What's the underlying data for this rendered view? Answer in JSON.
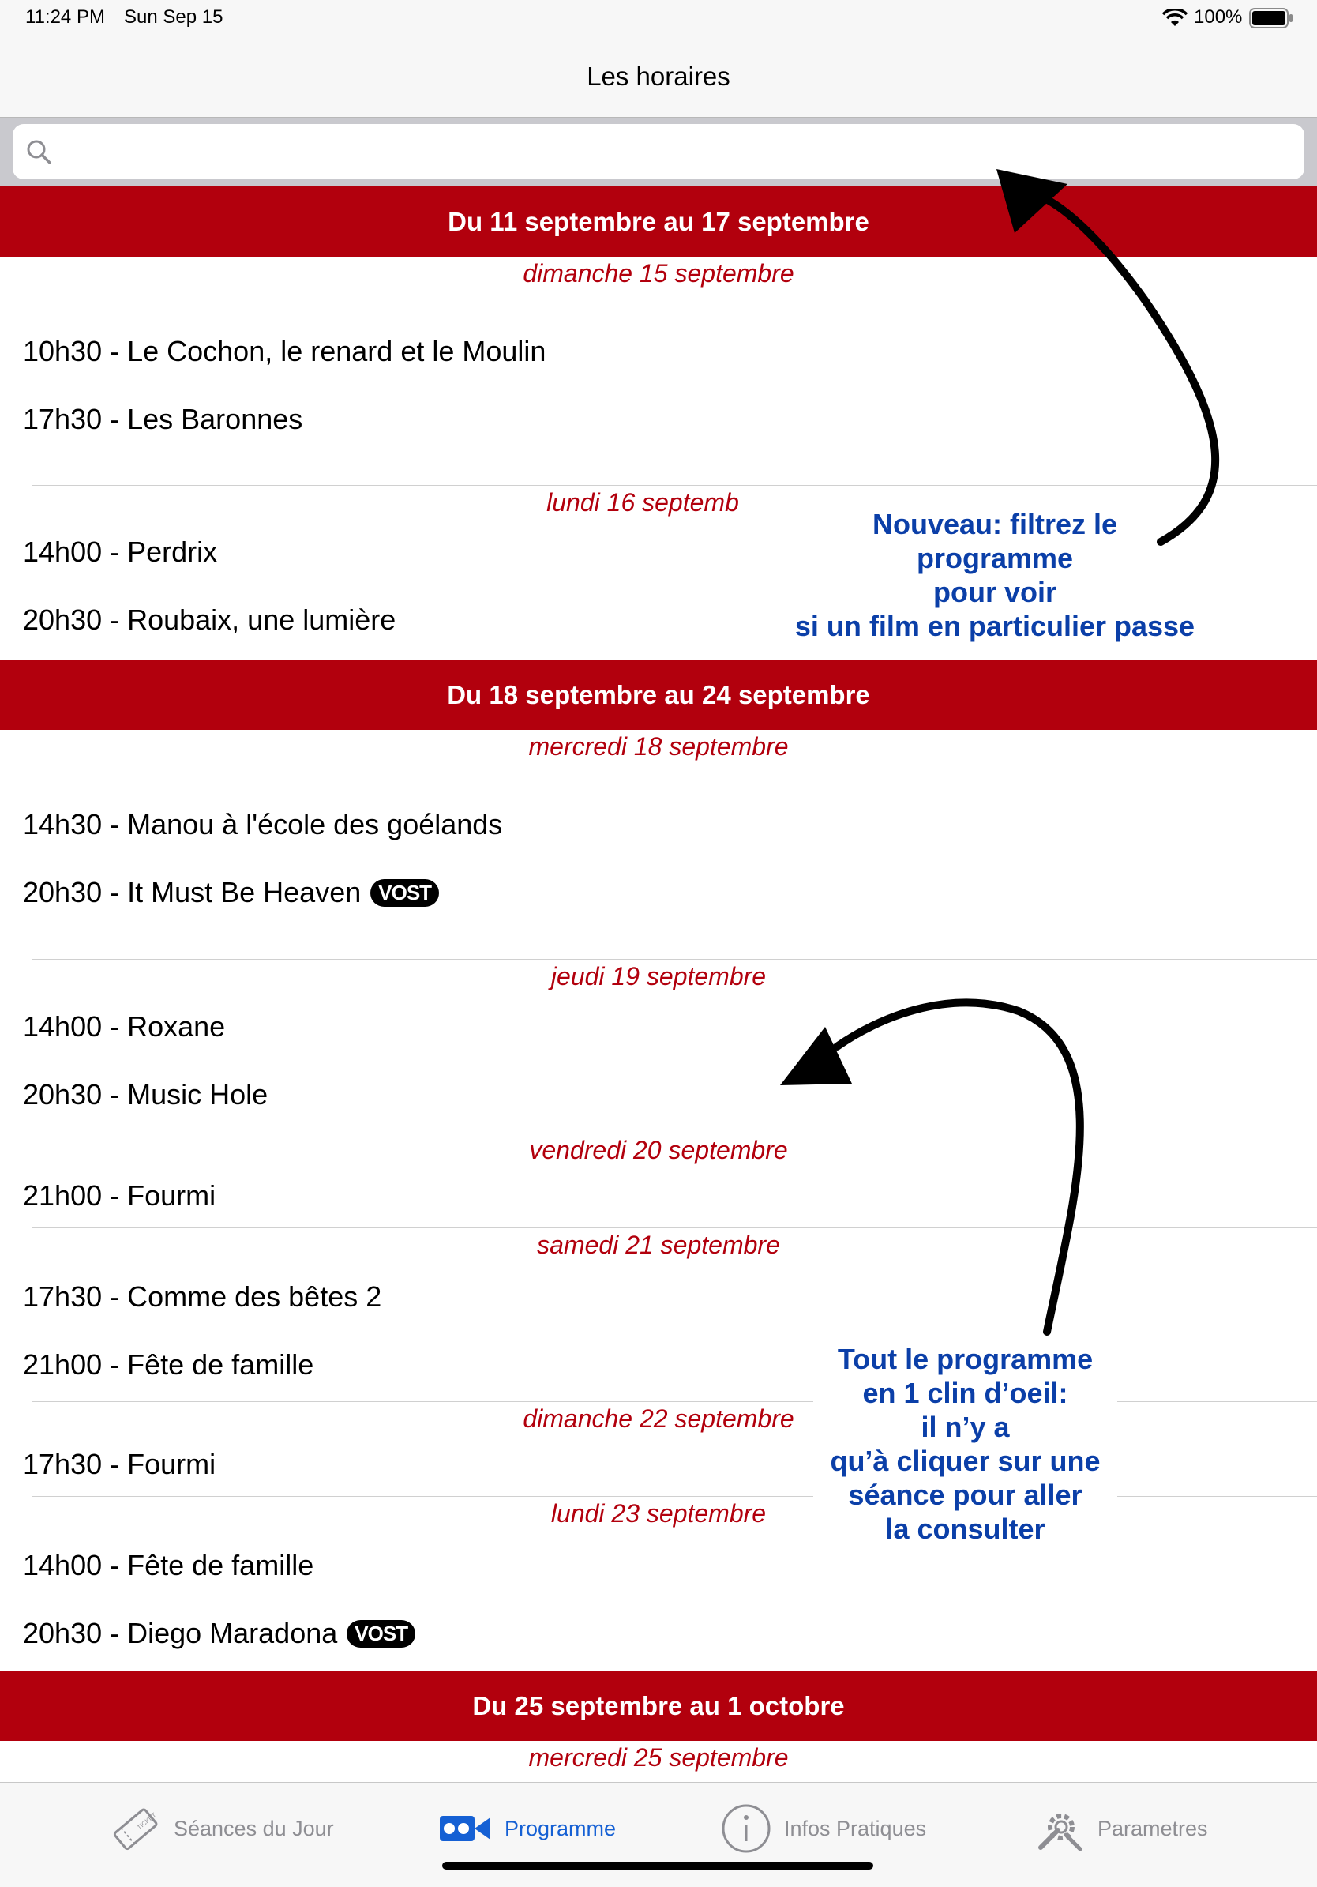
{
  "status": {
    "time": "11:24 PM",
    "date": "Sun Sep 15",
    "battery": "100%"
  },
  "nav": {
    "title": "Les horaires"
  },
  "search": {
    "placeholder": ""
  },
  "schedule": {
    "week1": {
      "title": "Du 11 septembre au 17 septembre",
      "day1": {
        "label": "dimanche 15 septembre",
        "s1": "10h30 - Le Cochon, le renard et le Moulin",
        "s2": "17h30 - Les Baronnes"
      },
      "day2": {
        "label": "lundi 16 septemb",
        "s1": "14h00 - Perdrix",
        "s2": "20h30 - Roubaix, une lumière"
      }
    },
    "week2": {
      "title": "Du 18 septembre au 24 septembre",
      "day1": {
        "label": "mercredi 18 septembre",
        "s1": "14h30 - Manou à l'école des goélands",
        "s2": "20h30 - It Must Be Heaven",
        "s2_badge": "VOST"
      },
      "day2": {
        "label": "jeudi 19 septembre",
        "s1": "14h00 - Roxane",
        "s2": "20h30 - Music Hole"
      },
      "day3": {
        "label": "vendredi 20 septembre",
        "s1": "21h00 - Fourmi"
      },
      "day4": {
        "label": "samedi 21 septembre",
        "s1": "17h30 - Comme des bêtes 2",
        "s2": "21h00 - Fête de famille"
      },
      "day5": {
        "label": "dimanche 22 septembre",
        "s1": "17h30 - Fourmi"
      },
      "day6": {
        "label": "lundi 23 septembre",
        "s1": "14h00 - Fête de famille",
        "s2": "20h30 - Diego Maradona",
        "s2_badge": "VOST"
      }
    },
    "week3": {
      "title": "Du 25 septembre au 1 octobre",
      "day1": {
        "label": "mercredi 25 septembre"
      }
    }
  },
  "annotations": {
    "a1": [
      "Nouveau: filtrez le",
      "programme",
      "pour voir",
      "si un film en particulier passe"
    ],
    "a2": [
      "Tout le programme",
      "en 1 clin d’oeil:",
      "il n’y a",
      "qu’à cliquer sur une",
      "séance  pour aller",
      "la consulter"
    ]
  },
  "tabs": {
    "t1": {
      "label": "Séances du Jour",
      "icon": "ticket-icon"
    },
    "t2": {
      "label": "Programme",
      "icon": "camera-icon",
      "active": true
    },
    "t3": {
      "label": "Infos Pratiques",
      "icon": "info-icon"
    },
    "t4": {
      "label": "Parametres",
      "icon": "tools-icon"
    }
  },
  "colors": {
    "accent_red": "#b2000d",
    "annotation_blue": "#0b3fa8",
    "tab_active": "#1560d4"
  }
}
